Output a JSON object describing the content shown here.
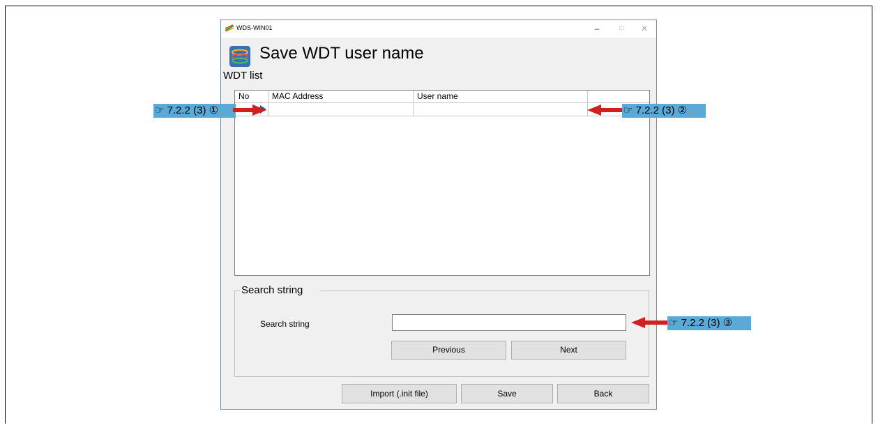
{
  "window": {
    "title": "WDS-WIN01",
    "controls": {
      "minimize": "–",
      "maximize": "□",
      "close": "✕"
    }
  },
  "header": {
    "title": "Save WDT user name",
    "icon": "coil-logo-icon"
  },
  "wdt_list": {
    "label": "WDT list",
    "columns": [
      "No",
      "MAC Address",
      "User name"
    ],
    "rows": [
      {
        "no": "",
        "mac": "",
        "user": ""
      }
    ]
  },
  "search": {
    "group_label": "Search string",
    "field_label": "Search string",
    "value": "",
    "previous_label": "Previous",
    "next_label": "Next"
  },
  "footer": {
    "import_label": "Import (.init file)",
    "save_label": "Save",
    "back_label": "Back"
  },
  "callouts": {
    "c1": "☞ 7.2.2 (3) ①",
    "c2": "☞ 7.2.2 (3) ②",
    "c3": "☞ 7.2.2 (3) ③"
  },
  "colors": {
    "callout_bg": "#5aa9d6",
    "arrow": "#d22020",
    "row_indicator": "#1a5aa8"
  }
}
